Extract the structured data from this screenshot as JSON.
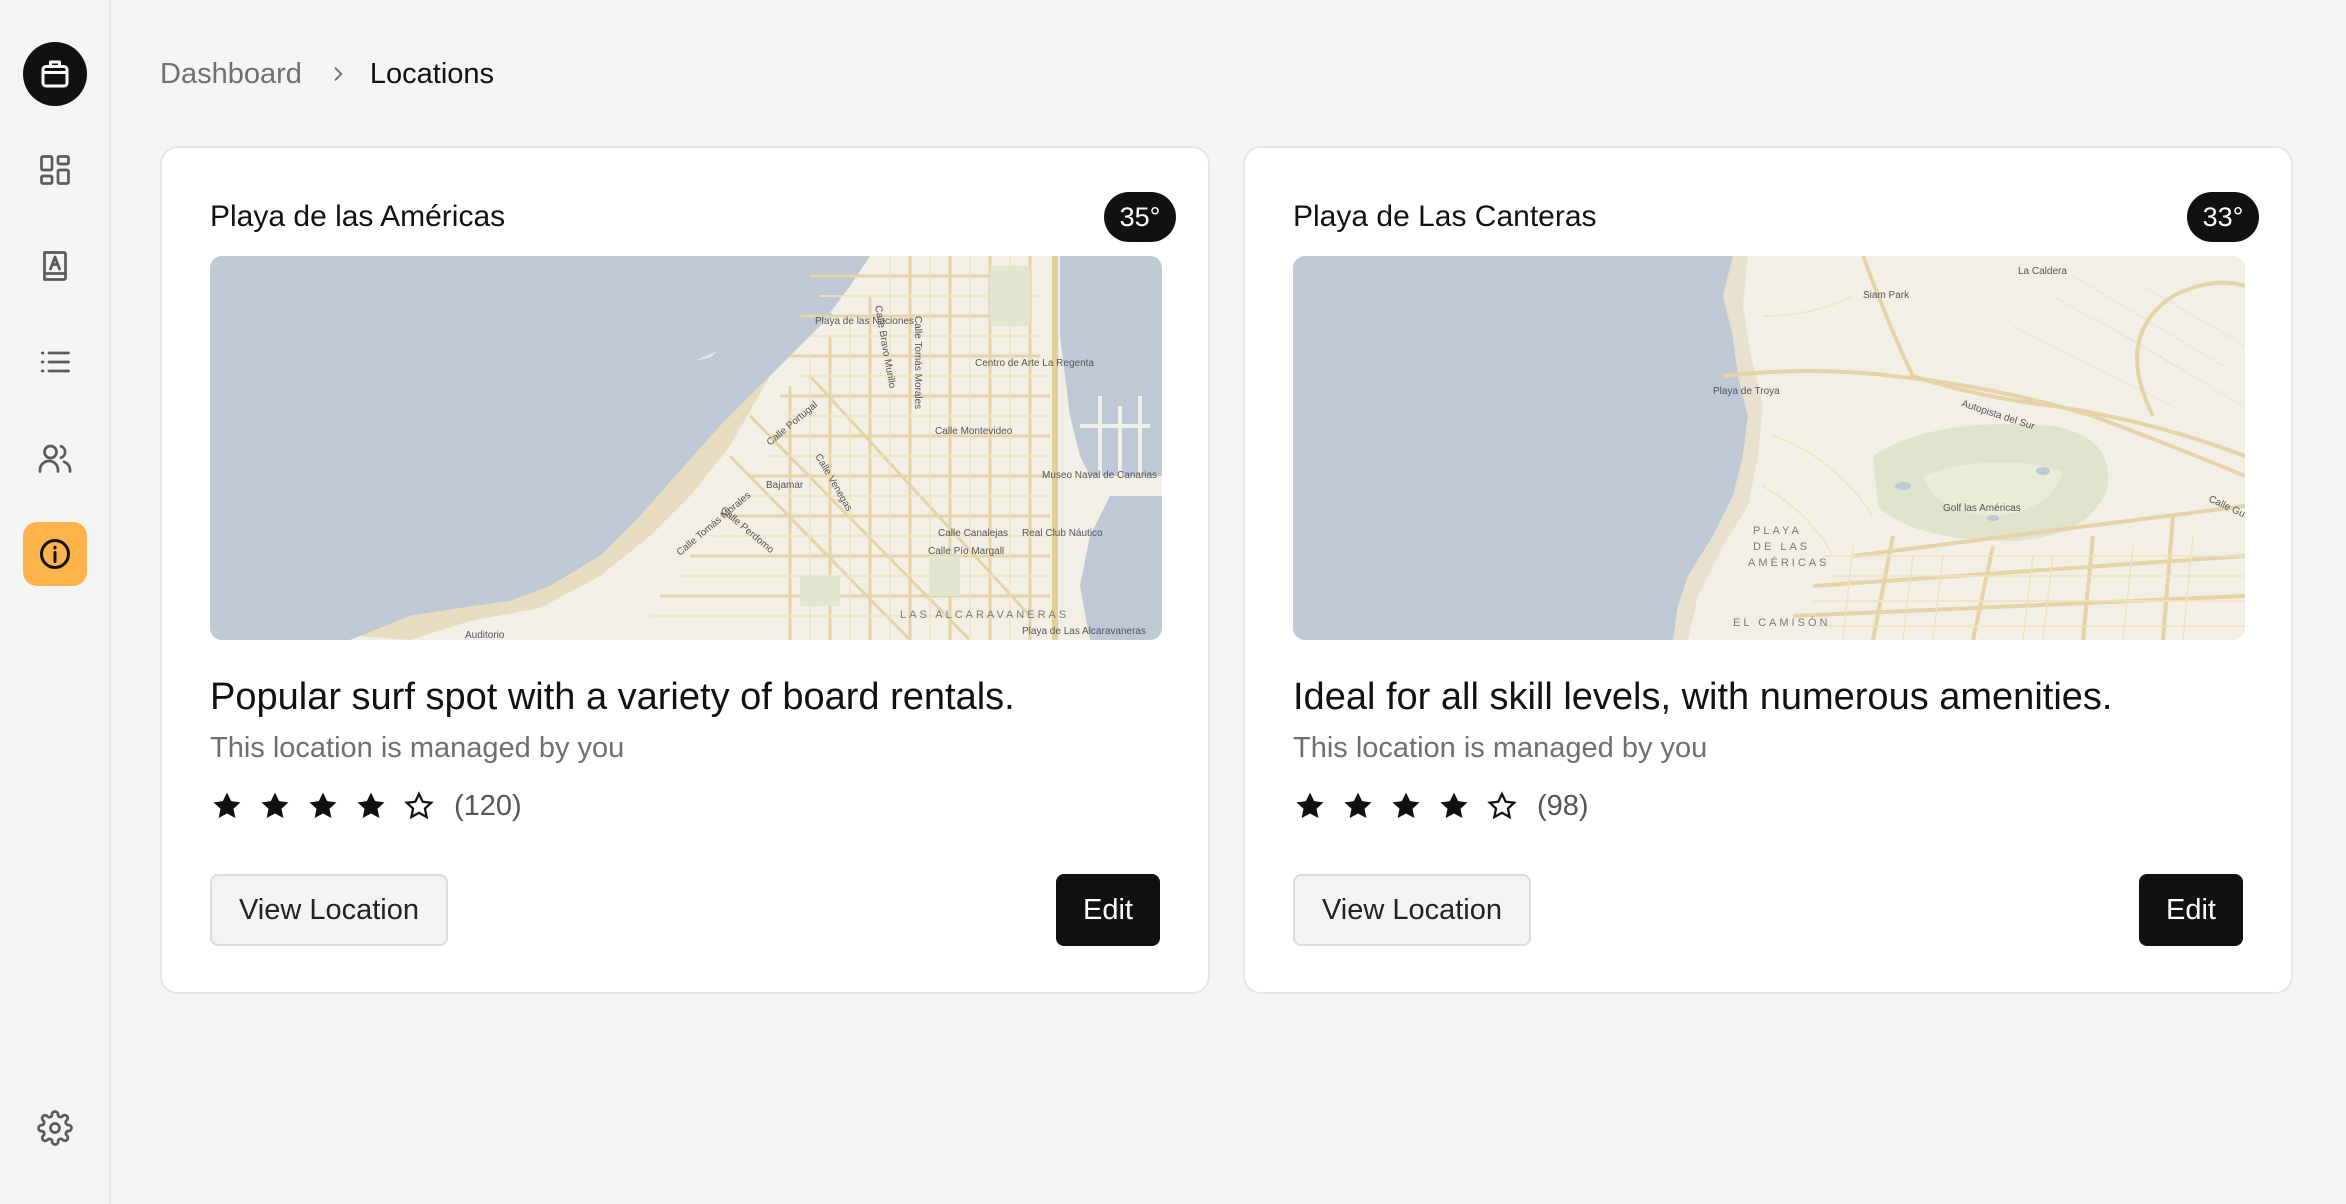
{
  "sidebar": {
    "items": [
      {
        "icon": "package-icon",
        "name": "logo"
      },
      {
        "icon": "dashboard-icon",
        "name": "dashboard"
      },
      {
        "icon": "contacts-book-icon",
        "name": "contacts"
      },
      {
        "icon": "list-icon",
        "name": "list"
      },
      {
        "icon": "users-icon",
        "name": "users"
      },
      {
        "icon": "info-icon",
        "name": "info",
        "active": true
      }
    ],
    "bottom": {
      "icon": "gear-icon",
      "name": "settings"
    },
    "accent": "#fdb24a"
  },
  "breadcrumb": {
    "parent": "Dashboard",
    "current": "Locations"
  },
  "locations": [
    {
      "name": "Playa de las Américas",
      "temperature": "35°",
      "description": "Popular surf spot with a variety of board rentals.",
      "managed": "This location is managed by you",
      "rating": 4,
      "rating_max": 5,
      "reviews": "(120)",
      "view_label": "View Location",
      "edit_label": "Edit",
      "map_labels": {
        "a": "Playa de las Naciones",
        "b": "Centro de Arte La Regenta",
        "c": "Calle Montevideo",
        "d": "Museo Naval de Canarias",
        "e": "Bajamar",
        "f": "Real Club Náutico",
        "g": "Calle Canalejas",
        "h": "Calle Pío Margall",
        "i": "LAS ALCARAVANERAS",
        "j": "Auditorio",
        "k": "Playa de Las Alcaravaneras",
        "l": "Calle Portugal",
        "m": "Calle Venegas",
        "n": "Calle Perdomo",
        "o": "Calle Tomás Morales",
        "p": "Calle Tomás Morales",
        "q": "Calle Bravo Murillo"
      }
    },
    {
      "name": "Playa de Las Canteras",
      "temperature": "33°",
      "description": "Ideal for all skill levels, with numerous amenities.",
      "managed": "This location is managed by you",
      "rating": 4,
      "rating_max": 5,
      "reviews": "(98)",
      "view_label": "View Location",
      "edit_label": "Edit",
      "map_labels": {
        "a": "La Caldera",
        "b": "Siam Park",
        "c": "Playa de Troya",
        "d": "Autopista del Sur",
        "e": "Golf las Américas",
        "f": "PLAYA",
        "g": "DE LAS",
        "h": "AMÉRICAS",
        "i": "EL CAMISÓN",
        "j": "Calle Gu"
      }
    }
  ]
}
